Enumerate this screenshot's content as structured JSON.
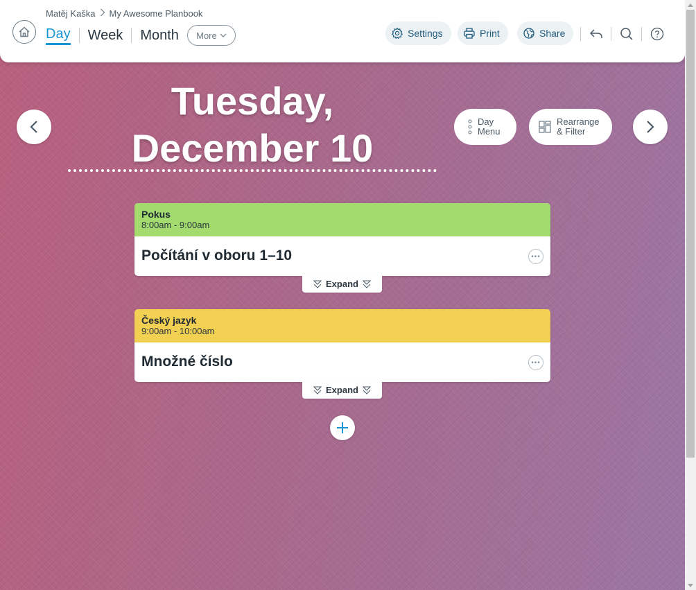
{
  "header": {
    "breadcrumb": {
      "user": "Matěj Kaška",
      "planbook": "My Awesome Planbook"
    },
    "tabs": [
      {
        "label": "Day",
        "active": true
      },
      {
        "label": "Week",
        "active": false
      },
      {
        "label": "Month",
        "active": false
      }
    ],
    "more_label": "More",
    "settings_label": "Settings",
    "print_label": "Print",
    "share_label": "Share",
    "icons": [
      "home-icon",
      "gear-icon",
      "printer-icon",
      "globe-icon",
      "undo-icon",
      "search-icon",
      "help-icon"
    ]
  },
  "day": {
    "title_line1": "Tuesday,",
    "title_line2": "December 10",
    "day_menu_line1": "Day",
    "day_menu_line2": "Menu",
    "rearrange_line1": "Rearrange",
    "rearrange_line2": "& Filter"
  },
  "lessons": [
    {
      "subject": "Pokus",
      "time": "8:00am - 9:00am",
      "title": "Počítání v oboru 1–10",
      "color": "#a3db6e",
      "expand_label": "Expand"
    },
    {
      "subject": "Český jazyk",
      "time": "9:00am - 10:00am",
      "title": "Množné číslo",
      "color": "#f2d052",
      "expand_label": "Expand"
    }
  ],
  "colors": {
    "accent": "#1a94d4",
    "header_bg": "#ffffff"
  }
}
